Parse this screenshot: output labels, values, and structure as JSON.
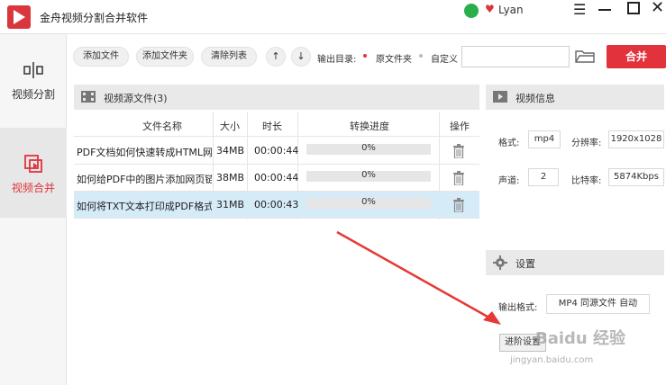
{
  "app": {
    "title": "金舟视频分割合并软件",
    "username": "Lyan"
  },
  "sidebar": {
    "items": [
      {
        "label": "视频分割",
        "active": false
      },
      {
        "label": "视频合并",
        "active": true
      }
    ]
  },
  "toolbar": {
    "add_file": "添加文件",
    "add_folder": "添加文件夹",
    "clear_list": "清除列表",
    "move_up": "↑",
    "move_down": "↓",
    "output_label": "输出目录:",
    "option_source": "原文件夹",
    "option_custom": "自定义",
    "path_value": "",
    "merge": "合并"
  },
  "source_panel": {
    "title": "视频源文件(3)",
    "columns": [
      "文件名称",
      "大小",
      "时长",
      "转换进度",
      "操作"
    ],
    "rows": [
      {
        "name": "PDF文档如何快速转成HTML网...",
        "size": "34MB",
        "duration": "00:00:44",
        "progress": "0%",
        "progress_value": 0,
        "selected": false
      },
      {
        "name": "如何给PDF中的图片添加网页链...",
        "size": "38MB",
        "duration": "00:00:44",
        "progress": "0%",
        "progress_value": 0,
        "selected": false
      },
      {
        "name": "如何将TXT文本打印成PDF格式...",
        "size": "31MB",
        "duration": "00:00:43",
        "progress": "0%",
        "progress_value": 0,
        "selected": true
      }
    ]
  },
  "video_info": {
    "title": "视频信息",
    "format_label": "格式:",
    "format_value": "mp4",
    "resolution_label": "分辨率:",
    "resolution_value": "1920x1028",
    "channel_label": "声道:",
    "channel_value": "2",
    "bitrate_label": "比特率:",
    "bitrate_value": "5874Kbps"
  },
  "settings": {
    "title": "设置",
    "output_format_label": "输出格式:",
    "output_format_value": "MP4 同源文件 自动",
    "advanced_button": "进阶设置"
  },
  "watermark": {
    "brand": "Baidu 经验",
    "url": "jingyan.baidu.com"
  },
  "colors": {
    "accent": "#e2333c",
    "selected_row": "#d6ebf8",
    "panel_header": "#e9e9e9"
  }
}
